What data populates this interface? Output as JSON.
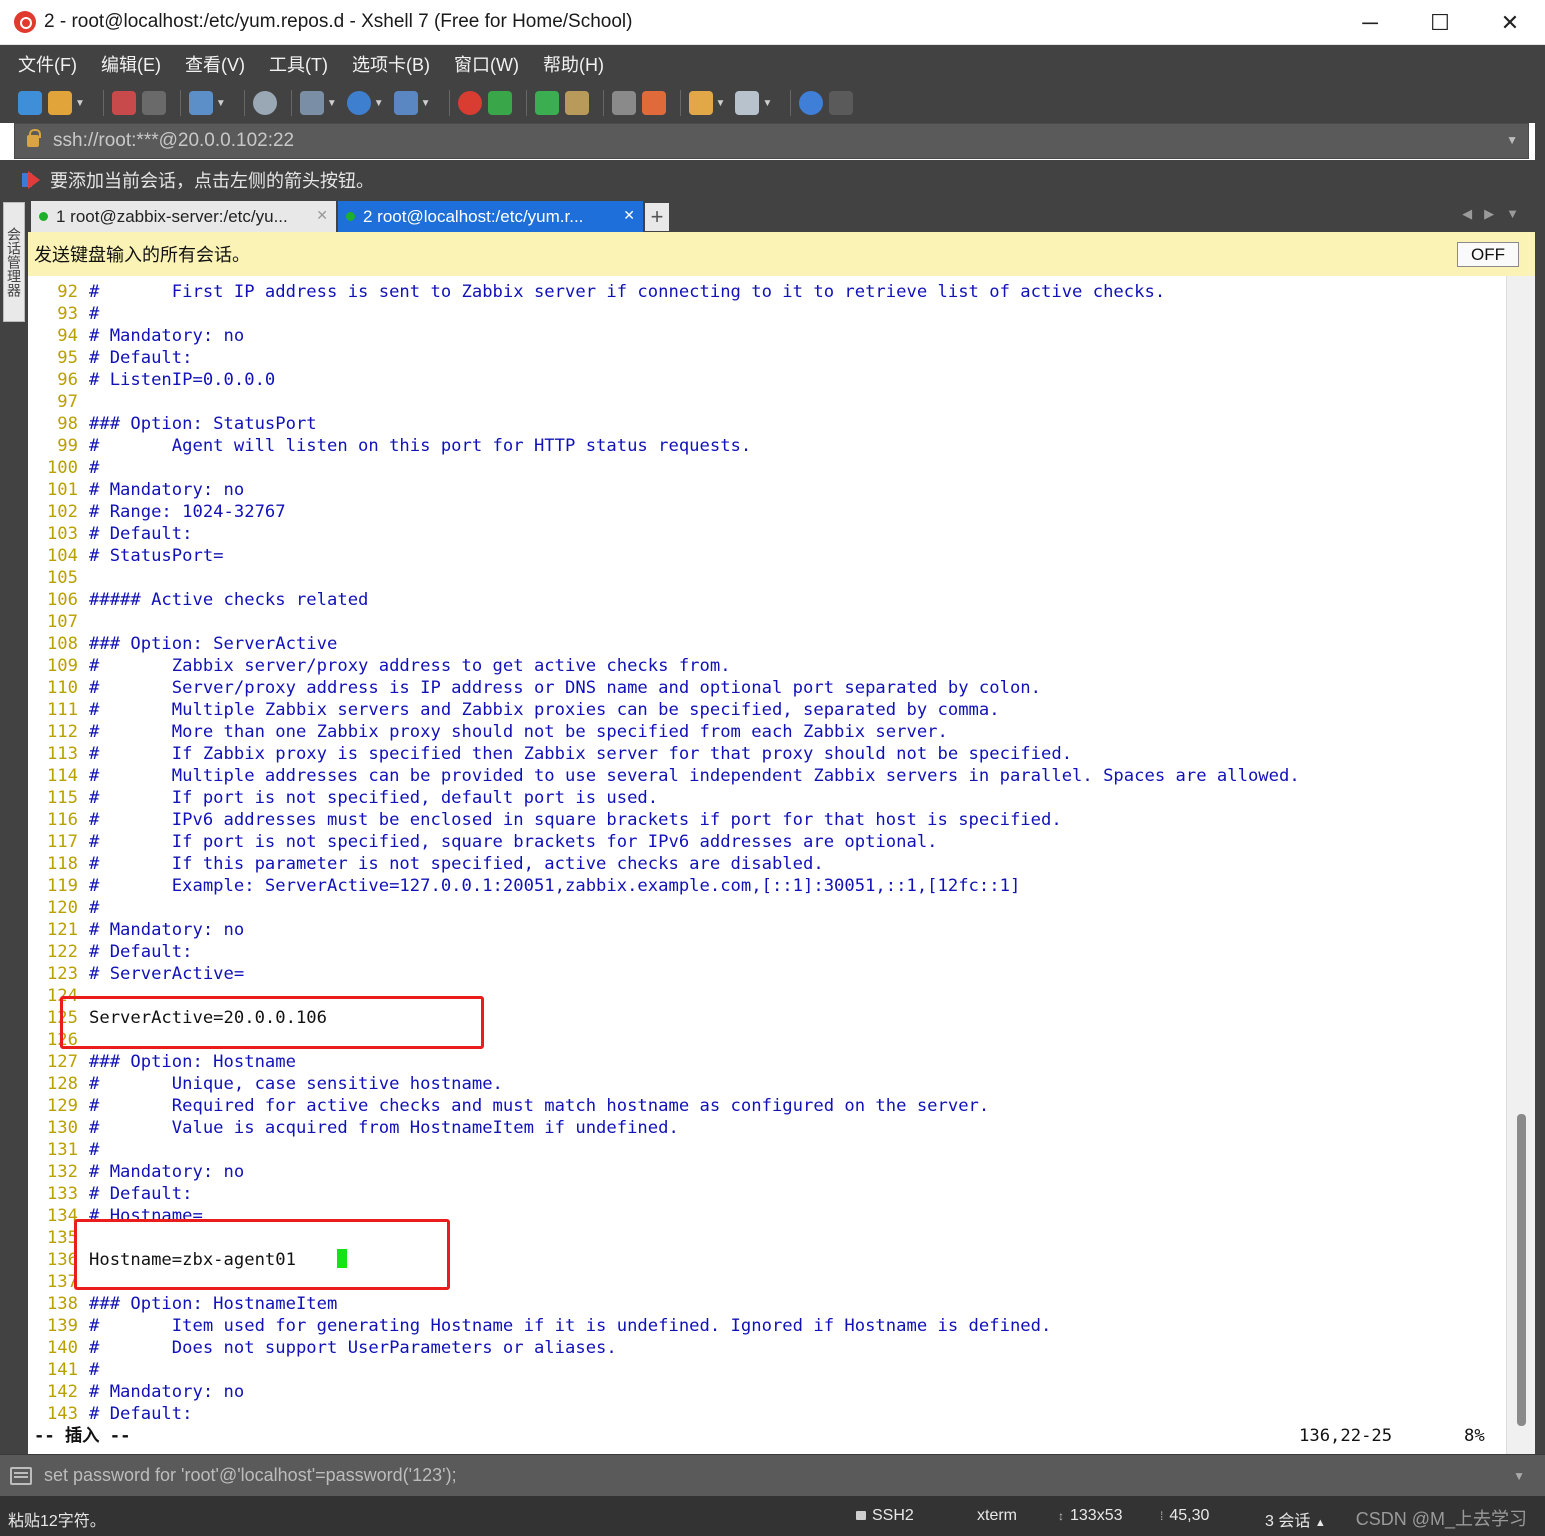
{
  "window": {
    "title": "2 - root@localhost:/etc/yum.repos.d - Xshell 7 (Free for Home/School)",
    "minimize": "─",
    "maximize": "☐",
    "close": "✕"
  },
  "menu": [
    "文件(F)",
    "编辑(E)",
    "查看(V)",
    "工具(T)",
    "选项卡(B)",
    "窗口(W)",
    "帮助(H)"
  ],
  "address": {
    "value": "ssh://root:***@20.0.0.102:22"
  },
  "hint": {
    "text": "要添加当前会话，点击左侧的箭头按钮。"
  },
  "side_panel": {
    "label": "会话管理器"
  },
  "tabs": [
    {
      "label": "1 root@zabbix-server:/etc/yu...",
      "active": false,
      "status_color": "#1eb02a"
    },
    {
      "label": "2 root@localhost:/etc/yum.r...",
      "active": true,
      "status_color": "#1eb02a"
    }
  ],
  "broadcast": {
    "text": "发送键盘输入的所有会话。",
    "toggle_label": "OFF"
  },
  "terminal": {
    "lines": [
      {
        "num": "92",
        "text": "#       First IP address is sent to Zabbix server if connecting to it to retrieve list of active checks."
      },
      {
        "num": "93",
        "text": "#"
      },
      {
        "num": "94",
        "text": "# Mandatory: no"
      },
      {
        "num": "95",
        "text": "# Default:"
      },
      {
        "num": "96",
        "text": "# ListenIP=0.0.0.0"
      },
      {
        "num": "97",
        "text": ""
      },
      {
        "num": "98",
        "text": "### Option: StatusPort"
      },
      {
        "num": "99",
        "text": "#       Agent will listen on this port for HTTP status requests."
      },
      {
        "num": "100",
        "text": "#"
      },
      {
        "num": "101",
        "text": "# Mandatory: no"
      },
      {
        "num": "102",
        "text": "# Range: 1024-32767"
      },
      {
        "num": "103",
        "text": "# Default:"
      },
      {
        "num": "104",
        "text": "# StatusPort="
      },
      {
        "num": "105",
        "text": ""
      },
      {
        "num": "106",
        "text": "##### Active checks related"
      },
      {
        "num": "107",
        "text": ""
      },
      {
        "num": "108",
        "text": "### Option: ServerActive"
      },
      {
        "num": "109",
        "text": "#       Zabbix server/proxy address to get active checks from."
      },
      {
        "num": "110",
        "text": "#       Server/proxy address is IP address or DNS name and optional port separated by colon."
      },
      {
        "num": "111",
        "text": "#       Multiple Zabbix servers and Zabbix proxies can be specified, separated by comma."
      },
      {
        "num": "112",
        "text": "#       More than one Zabbix proxy should not be specified from each Zabbix server."
      },
      {
        "num": "113",
        "text": "#       If Zabbix proxy is specified then Zabbix server for that proxy should not be specified."
      },
      {
        "num": "114",
        "text": "#       Multiple addresses can be provided to use several independent Zabbix servers in parallel. Spaces are allowed."
      },
      {
        "num": "115",
        "text": "#       If port is not specified, default port is used."
      },
      {
        "num": "116",
        "text": "#       IPv6 addresses must be enclosed in square brackets if port for that host is specified."
      },
      {
        "num": "117",
        "text": "#       If port is not specified, square brackets for IPv6 addresses are optional."
      },
      {
        "num": "118",
        "text": "#       If this parameter is not specified, active checks are disabled."
      },
      {
        "num": "119",
        "text": "#       Example: ServerActive=127.0.0.1:20051,zabbix.example.com,[::1]:30051,::1,[12fc::1]"
      },
      {
        "num": "120",
        "text": "#"
      },
      {
        "num": "121",
        "text": "# Mandatory: no"
      },
      {
        "num": "122",
        "text": "# Default:"
      },
      {
        "num": "123",
        "text": "# ServerActive="
      },
      {
        "num": "124",
        "text": ""
      },
      {
        "num": "125",
        "text": "ServerActive=20.0.0.106",
        "plain": true
      },
      {
        "num": "126",
        "text": ""
      },
      {
        "num": "127",
        "text": "### Option: Hostname"
      },
      {
        "num": "128",
        "text": "#       Unique, case sensitive hostname."
      },
      {
        "num": "129",
        "text": "#       Required for active checks and must match hostname as configured on the server."
      },
      {
        "num": "130",
        "text": "#       Value is acquired from HostnameItem if undefined."
      },
      {
        "num": "131",
        "text": "#"
      },
      {
        "num": "132",
        "text": "# Mandatory: no"
      },
      {
        "num": "133",
        "text": "# Default:"
      },
      {
        "num": "134",
        "text": "# Hostname="
      },
      {
        "num": "135",
        "text": ""
      },
      {
        "num": "136",
        "text": "Hostname=zbx-agent01    ",
        "plain": true,
        "cursor": true
      },
      {
        "num": "137",
        "text": ""
      },
      {
        "num": "138",
        "text": "### Option: HostnameItem"
      },
      {
        "num": "139",
        "text": "#       Item used for generating Hostname if it is undefined. Ignored if Hostname is defined."
      },
      {
        "num": "140",
        "text": "#       Does not support UserParameters or aliases."
      },
      {
        "num": "141",
        "text": "#"
      },
      {
        "num": "142",
        "text": "# Mandatory: no"
      },
      {
        "num": "143",
        "text": "# Default:"
      }
    ],
    "mode": "-- 插入 --",
    "position": "136,22-25",
    "percent": "8%",
    "cursor_color": "#14e414",
    "highlight_color": "#ea1c1c"
  },
  "compose": {
    "text": "set password for 'root'@'localhost'=password('123');"
  },
  "statusbar": {
    "message": "粘贴12字符。",
    "protocol": "SSH2",
    "terminal_type": "xterm",
    "size": "133x53",
    "cursor_pos": "45,30",
    "sessions": "3 会话",
    "watermark": "CSDN @M_上去学习"
  }
}
